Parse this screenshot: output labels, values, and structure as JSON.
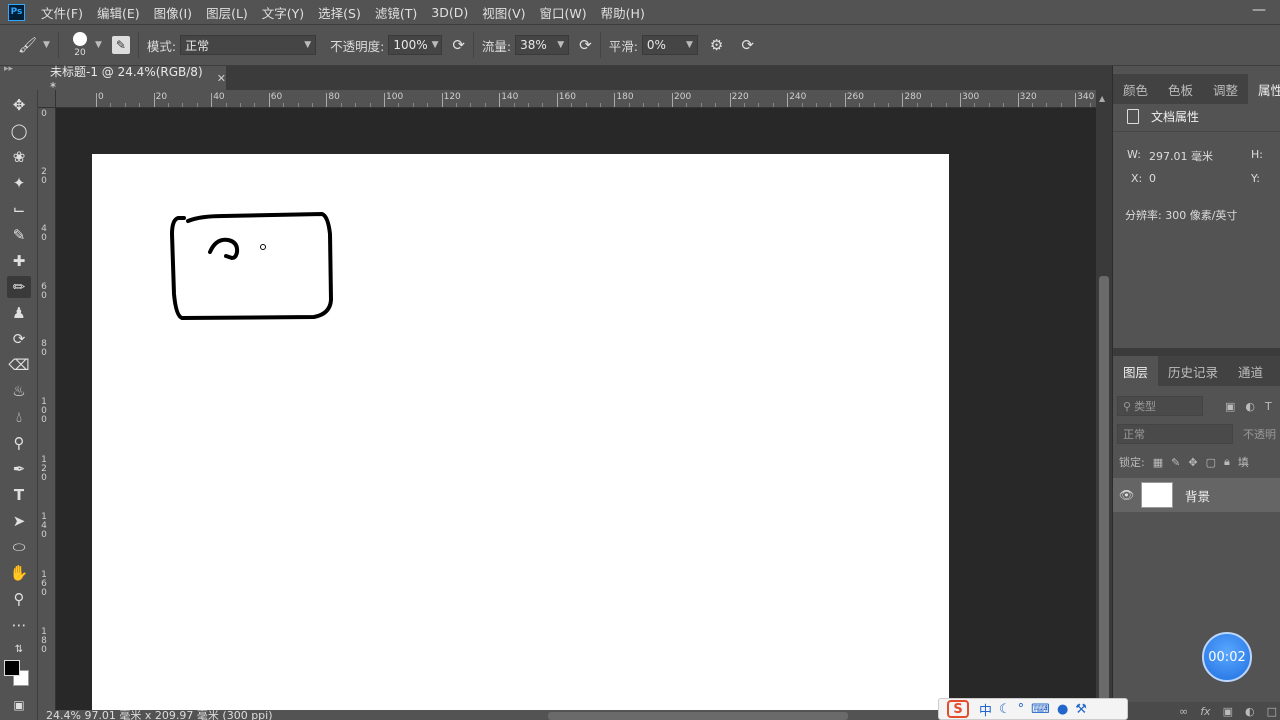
{
  "app": {
    "logo": "Ps"
  },
  "menu": [
    "文件(F)",
    "编辑(E)",
    "图像(I)",
    "图层(L)",
    "文字(Y)",
    "选择(S)",
    "滤镜(T)",
    "3D(D)",
    "视图(V)",
    "窗口(W)",
    "帮助(H)"
  ],
  "options": {
    "brush_size": "20",
    "mode_label": "模式:",
    "mode_value": "正常",
    "opacity_label": "不透明度:",
    "opacity_value": "100%",
    "flow_label": "流量:",
    "flow_value": "38%",
    "smooth_label": "平滑:",
    "smooth_value": "0%"
  },
  "document": {
    "tab_title": "未标题-1 @ 24.4%(RGB/8) *",
    "status": "24.4%   97.01 毫米 x 209.97 毫米 (300 ppi)"
  },
  "ruler": {
    "h_labels": [
      "0",
      "20",
      "40",
      "60",
      "80",
      "100",
      "120",
      "140",
      "160",
      "180",
      "200",
      "220",
      "240",
      "260",
      "280",
      "300",
      "320",
      "340"
    ],
    "v_labels": [
      "0",
      "2 0",
      "4 0",
      "6 0",
      "8 0",
      "1 0 0",
      "1 2 0",
      "1 4 0",
      "1 6 0",
      "1 8 0"
    ]
  },
  "panels": {
    "top_tabs": [
      "颜色",
      "色板",
      "调整",
      "属性"
    ],
    "props_title": "文档属性",
    "w_label": "W:",
    "w_value": "297.01 毫米",
    "h_label": "H:",
    "x_label": "X:",
    "x_value": "0",
    "y_label": "Y:",
    "resolution": "分辨率: 300 像素/英寸",
    "layer_tabs": [
      "图层",
      "历史记录",
      "通道"
    ],
    "filter_kind": "类型",
    "blend_mode": "正常",
    "opacity_short": "不透明",
    "lock_label": "锁定:",
    "fill_short": "填",
    "layer_name": "背景"
  },
  "overlay": {
    "timer": "00:02",
    "ime_logo": "S",
    "ime_lang": "中"
  }
}
